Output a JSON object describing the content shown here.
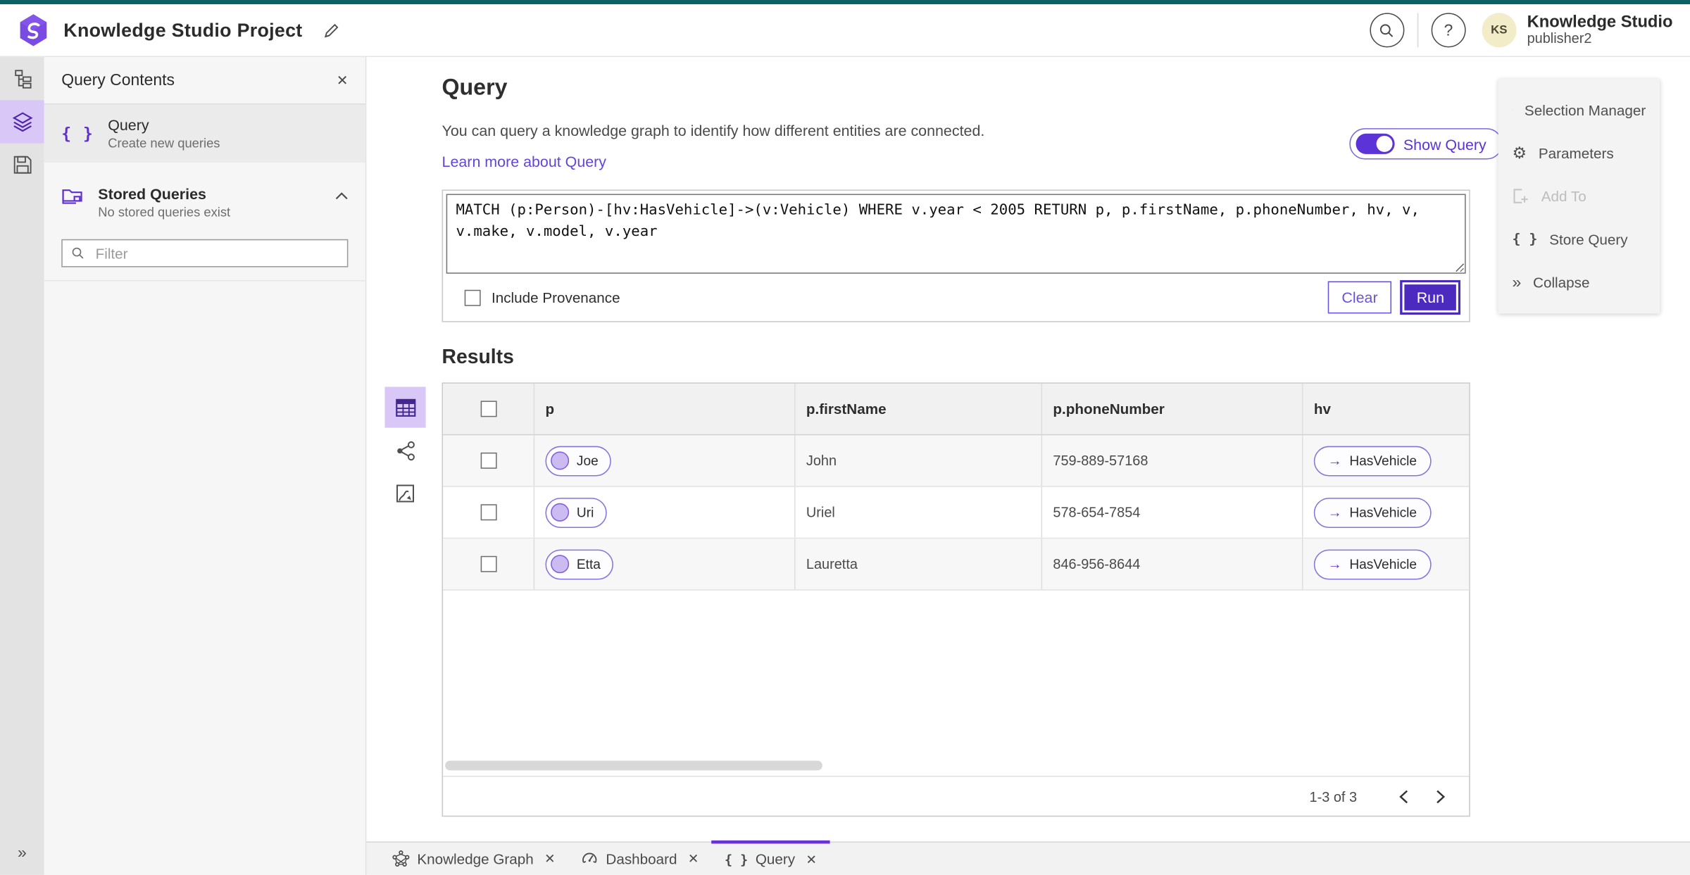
{
  "topbar": {
    "title": "Knowledge Studio Project",
    "account_name": "Knowledge Studio",
    "account_role": "publisher2",
    "avatar_initials": "KS"
  },
  "panel": {
    "title": "Query Contents",
    "query_item": {
      "title": "Query",
      "subtitle": "Create new queries"
    },
    "stored": {
      "title": "Stored Queries",
      "subtitle": "No stored queries exist"
    },
    "filter_placeholder": "Filter"
  },
  "query": {
    "heading": "Query",
    "description": "You can query a knowledge graph to identify how different entities are connected.",
    "link": "Learn more about Query",
    "toggle_label": "Show Query",
    "text": "MATCH (p:Person)-[hv:HasVehicle]->(v:Vehicle) WHERE v.year < 2005 RETURN p, p.firstName, p.phoneNumber, hv, v, v.make, v.model, v.year",
    "provenance_label": "Include Provenance",
    "clear_label": "Clear",
    "run_label": "Run"
  },
  "results": {
    "heading": "Results",
    "columns": [
      "p",
      "p.firstName",
      "p.phoneNumber",
      "hv"
    ],
    "rows": [
      {
        "p": "Joe",
        "firstName": "John",
        "phone": "759-889-57168",
        "hv": "HasVehicle"
      },
      {
        "p": "Uri",
        "firstName": "Uriel",
        "phone": "578-654-7854",
        "hv": "HasVehicle"
      },
      {
        "p": "Etta",
        "firstName": "Lauretta",
        "phone": "846-956-8644",
        "hv": "HasVehicle"
      }
    ],
    "pagination": {
      "range": "1-3 of 3"
    }
  },
  "right_panel": {
    "items": [
      {
        "label": "Selection Manager"
      },
      {
        "label": "Parameters"
      },
      {
        "label": "Add To",
        "disabled": true
      },
      {
        "label": "Store Query"
      },
      {
        "label": "Collapse"
      }
    ]
  },
  "tabs": [
    {
      "label": "Knowledge Graph"
    },
    {
      "label": "Dashboard"
    },
    {
      "label": "Query",
      "active": true
    }
  ],
  "icons": {
    "close": "✕",
    "braces": "{ }",
    "help": "?",
    "gear": "⚙",
    "collapse_double": "»",
    "rail_expand": "»",
    "arrow_right": "→"
  },
  "colors": {
    "accent_purple": "#5b33d6",
    "run_button": "#4c2ac0",
    "teal_strip": "#0d6164",
    "active_highlight": "#d9c7f7",
    "avatar_bg": "#f2ecc9"
  }
}
